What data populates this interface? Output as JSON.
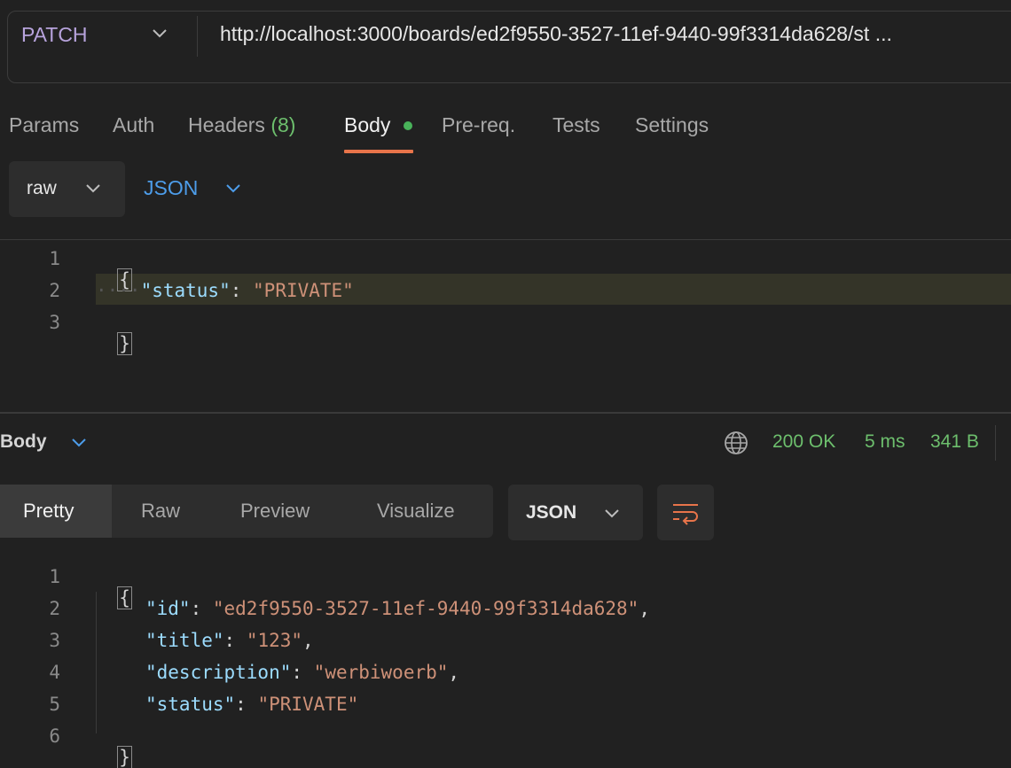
{
  "request": {
    "method": "PATCH",
    "url": "http://localhost:3000/boards/ed2f9550-3527-11ef-9440-99f3314da628/st ..."
  },
  "tabs": [
    {
      "label": "Params"
    },
    {
      "label": "Auth"
    },
    {
      "label": "Headers",
      "count": "(8)"
    },
    {
      "label": "Body",
      "active": true
    },
    {
      "label": "Pre-req."
    },
    {
      "label": "Tests"
    },
    {
      "label": "Settings"
    }
  ],
  "body_mode": {
    "type": "raw",
    "format": "JSON"
  },
  "request_body": {
    "line_numbers": [
      "1",
      "2",
      "3"
    ],
    "open_brace": "{",
    "key": "\"status\"",
    "colon": ": ",
    "value": "\"PRIVATE\"",
    "close_brace": "}"
  },
  "response": {
    "section_label": "Body",
    "status": "200 OK",
    "time": "5 ms",
    "size": "341 B",
    "views": [
      "Pretty",
      "Raw",
      "Preview",
      "Visualize"
    ],
    "active_view": "Pretty",
    "format": "JSON",
    "line_numbers": [
      "1",
      "2",
      "3",
      "4",
      "5",
      "6"
    ],
    "open_brace": "{",
    "fields": [
      {
        "key": "\"id\"",
        "value": "\"ed2f9550-3527-11ef-9440-99f3314da628\"",
        "sep": ","
      },
      {
        "key": "\"title\"",
        "value": "\"123\"",
        "sep": ","
      },
      {
        "key": "\"description\"",
        "value": "\"werbiwoerb\"",
        "sep": ","
      },
      {
        "key": "\"status\"",
        "value": "\"PRIVATE\"",
        "sep": ""
      }
    ]
  },
  "colors": {
    "accent": "#e8744a",
    "method": "#b7a3dc",
    "status_ok": "#6dbf6d",
    "link_blue": "#4d9dea"
  }
}
